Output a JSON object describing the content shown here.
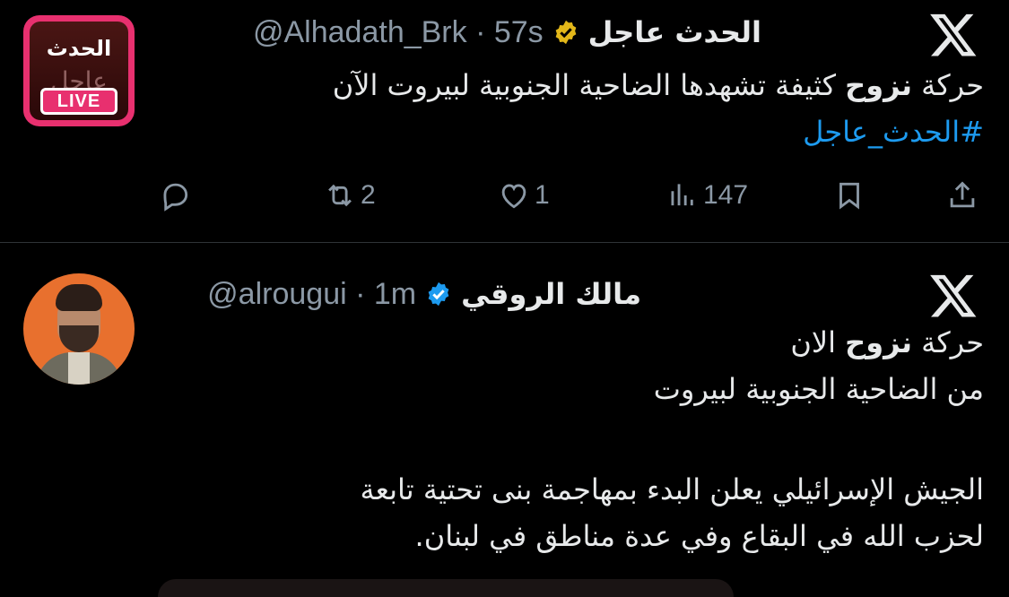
{
  "tweets": [
    {
      "name": "الحدث عاجل",
      "handle_line": "@Alhadath_Brk · 57s",
      "avatar": {
        "logo_text": "الحدث",
        "logo_text_2": "عاجل",
        "live_label": "LIVE"
      },
      "verified_color": "#e2b719",
      "body": {
        "pre": "حركة ",
        "bold": "نزوح",
        "post": " كثيفة تشهدها الضاحية الجنوبية لبيروت الآن"
      },
      "hashtag": "#الحدث_عاجل",
      "actions": {
        "reply_icon": "reply-icon",
        "retweet_count": "2",
        "like_count": "1",
        "views_count": "147",
        "bookmark_icon": "bookmark-icon",
        "share_icon": "share-icon"
      }
    },
    {
      "name": "مالك الروقي",
      "handle_line": "@alrougui · 1m",
      "verified_color": "#1d9bf0",
      "body": {
        "line1_pre": "حركة ",
        "line1_bold": "نزوح",
        "line1_post": " الان",
        "line2": "من الضاحية الجنوبية لبيروت",
        "line3": "الجيش الإسرائيلي يعلن البدء بمهاجمة بنى تحتية تابعة",
        "line4": "لحزب الله في البقاع وفي عدة مناطق في لبنان."
      }
    }
  ],
  "colors": {
    "background": "#000000",
    "text": "#e7e9ea",
    "muted": "#8b98a5",
    "link": "#1d9bf0",
    "divider": "#2f3336"
  }
}
